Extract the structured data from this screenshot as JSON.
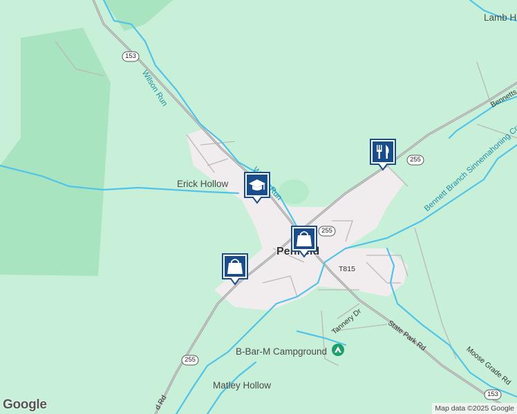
{
  "map": {
    "town": "Penfield",
    "place_labels": {
      "lamb_hollow": "Lamb H",
      "erick_hollow": "Erick Hollow",
      "campground": "B-Bar-M Campground",
      "matley_hollow": "Matley Hollow"
    },
    "water_labels": {
      "wilson_run_north": "Wilson Run",
      "wilson_run_south": "Wilson Run",
      "bennett_branch": "Bennett Branch Sinnemahoning Creek"
    },
    "road_labels": {
      "bennetts": "Bennetts V",
      "state_park_rd": "State Park Rd",
      "moose_grade_rd": "Moose Grade Rd",
      "tannery_dr": "Tannery Dr",
      "t815": "T815",
      "south_rd": "d Rd"
    },
    "shields": {
      "pa153_north": "153",
      "pa255_east": "255",
      "pa255_center": "255",
      "pa255_south": "255",
      "pa153_south": "153"
    },
    "markers": [
      {
        "name": "school-marker",
        "icon": "graduation-cap-icon"
      },
      {
        "name": "restaurant-marker",
        "icon": "fork-knife-icon"
      },
      {
        "name": "shopping-marker-center",
        "icon": "shopping-bag-icon"
      },
      {
        "name": "shopping-marker-west",
        "icon": "shopping-bag-icon"
      }
    ],
    "colors": {
      "land": "#c8f0d8",
      "forest_dark": "#a8e4c0",
      "urban": "#f1ecee",
      "water": "#4fc3e8",
      "road": "#aaaaaa",
      "marker": "#1a4d8c"
    }
  },
  "branding": {
    "logo": "Google",
    "attribution": "Map data ©2025 Google"
  }
}
